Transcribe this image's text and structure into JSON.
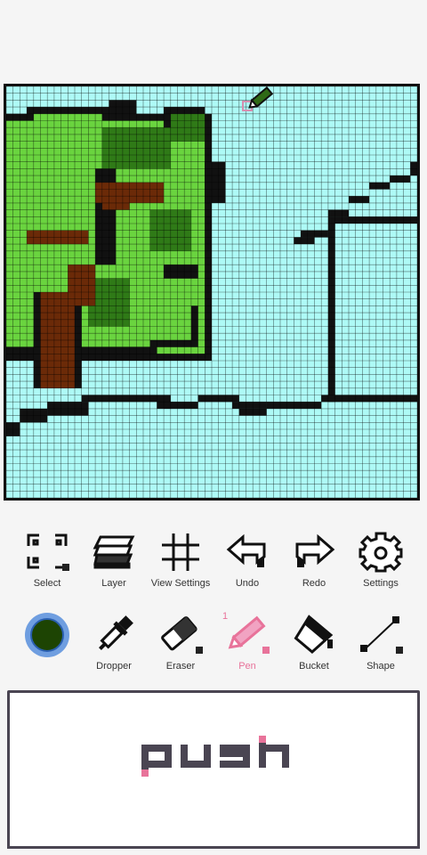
{
  "colors": {
    "canvas_bg": "#aefaf6",
    "outline": "#111111",
    "leaf_light": "#6ad43f",
    "leaf_dark": "#2f7a17",
    "trunk": "#6b2a08",
    "current_color": "#1d4403",
    "accent": "#e8739a"
  },
  "toolbar_row1": [
    {
      "label": "Select",
      "icon": "select-icon"
    },
    {
      "label": "Layer",
      "icon": "layer-icon"
    },
    {
      "label": "View Settings",
      "icon": "grid-icon"
    },
    {
      "label": "Undo",
      "icon": "undo-icon"
    },
    {
      "label": "Redo",
      "icon": "redo-icon"
    },
    {
      "label": "Settings",
      "icon": "gear-icon"
    }
  ],
  "toolbar_row2": [
    {
      "label": "Dropper",
      "icon": "dropper-icon"
    },
    {
      "label": "Eraser",
      "icon": "eraser-icon"
    },
    {
      "label": "Pen",
      "icon": "pen-icon",
      "active": true,
      "size": "1"
    },
    {
      "label": "Bucket",
      "icon": "bucket-icon"
    },
    {
      "label": "Shape",
      "icon": "shape-line-icon"
    }
  ],
  "push_button": {
    "label": "push"
  }
}
